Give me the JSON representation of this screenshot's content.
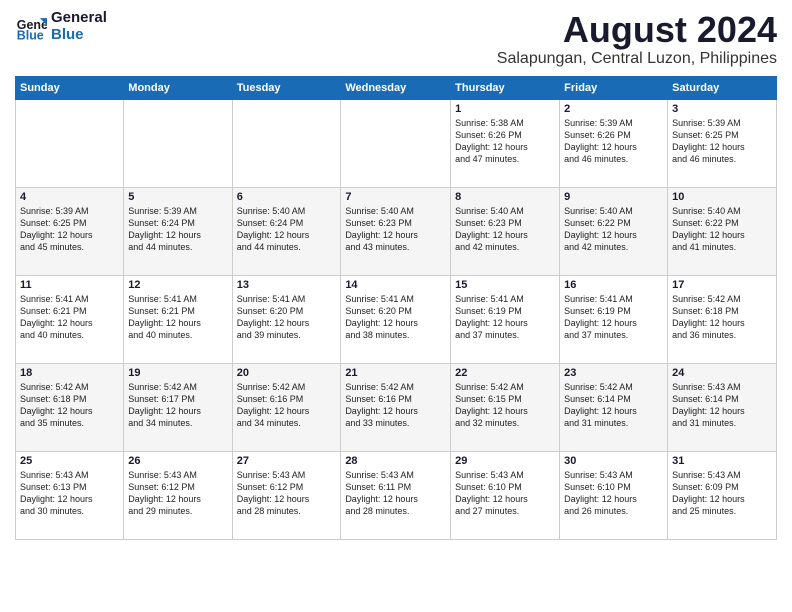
{
  "logo": {
    "line1": "General",
    "line2": "Blue"
  },
  "title": "August 2024",
  "subtitle": "Salapungan, Central Luzon, Philippines",
  "days_header": [
    "Sunday",
    "Monday",
    "Tuesday",
    "Wednesday",
    "Thursday",
    "Friday",
    "Saturday"
  ],
  "weeks": [
    [
      {
        "day": "",
        "info": ""
      },
      {
        "day": "",
        "info": ""
      },
      {
        "day": "",
        "info": ""
      },
      {
        "day": "",
        "info": ""
      },
      {
        "day": "1",
        "info": "Sunrise: 5:38 AM\nSunset: 6:26 PM\nDaylight: 12 hours\nand 47 minutes."
      },
      {
        "day": "2",
        "info": "Sunrise: 5:39 AM\nSunset: 6:26 PM\nDaylight: 12 hours\nand 46 minutes."
      },
      {
        "day": "3",
        "info": "Sunrise: 5:39 AM\nSunset: 6:25 PM\nDaylight: 12 hours\nand 46 minutes."
      }
    ],
    [
      {
        "day": "4",
        "info": "Sunrise: 5:39 AM\nSunset: 6:25 PM\nDaylight: 12 hours\nand 45 minutes."
      },
      {
        "day": "5",
        "info": "Sunrise: 5:39 AM\nSunset: 6:24 PM\nDaylight: 12 hours\nand 44 minutes."
      },
      {
        "day": "6",
        "info": "Sunrise: 5:40 AM\nSunset: 6:24 PM\nDaylight: 12 hours\nand 44 minutes."
      },
      {
        "day": "7",
        "info": "Sunrise: 5:40 AM\nSunset: 6:23 PM\nDaylight: 12 hours\nand 43 minutes."
      },
      {
        "day": "8",
        "info": "Sunrise: 5:40 AM\nSunset: 6:23 PM\nDaylight: 12 hours\nand 42 minutes."
      },
      {
        "day": "9",
        "info": "Sunrise: 5:40 AM\nSunset: 6:22 PM\nDaylight: 12 hours\nand 42 minutes."
      },
      {
        "day": "10",
        "info": "Sunrise: 5:40 AM\nSunset: 6:22 PM\nDaylight: 12 hours\nand 41 minutes."
      }
    ],
    [
      {
        "day": "11",
        "info": "Sunrise: 5:41 AM\nSunset: 6:21 PM\nDaylight: 12 hours\nand 40 minutes."
      },
      {
        "day": "12",
        "info": "Sunrise: 5:41 AM\nSunset: 6:21 PM\nDaylight: 12 hours\nand 40 minutes."
      },
      {
        "day": "13",
        "info": "Sunrise: 5:41 AM\nSunset: 6:20 PM\nDaylight: 12 hours\nand 39 minutes."
      },
      {
        "day": "14",
        "info": "Sunrise: 5:41 AM\nSunset: 6:20 PM\nDaylight: 12 hours\nand 38 minutes."
      },
      {
        "day": "15",
        "info": "Sunrise: 5:41 AM\nSunset: 6:19 PM\nDaylight: 12 hours\nand 37 minutes."
      },
      {
        "day": "16",
        "info": "Sunrise: 5:41 AM\nSunset: 6:19 PM\nDaylight: 12 hours\nand 37 minutes."
      },
      {
        "day": "17",
        "info": "Sunrise: 5:42 AM\nSunset: 6:18 PM\nDaylight: 12 hours\nand 36 minutes."
      }
    ],
    [
      {
        "day": "18",
        "info": "Sunrise: 5:42 AM\nSunset: 6:18 PM\nDaylight: 12 hours\nand 35 minutes."
      },
      {
        "day": "19",
        "info": "Sunrise: 5:42 AM\nSunset: 6:17 PM\nDaylight: 12 hours\nand 34 minutes."
      },
      {
        "day": "20",
        "info": "Sunrise: 5:42 AM\nSunset: 6:16 PM\nDaylight: 12 hours\nand 34 minutes."
      },
      {
        "day": "21",
        "info": "Sunrise: 5:42 AM\nSunset: 6:16 PM\nDaylight: 12 hours\nand 33 minutes."
      },
      {
        "day": "22",
        "info": "Sunrise: 5:42 AM\nSunset: 6:15 PM\nDaylight: 12 hours\nand 32 minutes."
      },
      {
        "day": "23",
        "info": "Sunrise: 5:42 AM\nSunset: 6:14 PM\nDaylight: 12 hours\nand 31 minutes."
      },
      {
        "day": "24",
        "info": "Sunrise: 5:43 AM\nSunset: 6:14 PM\nDaylight: 12 hours\nand 31 minutes."
      }
    ],
    [
      {
        "day": "25",
        "info": "Sunrise: 5:43 AM\nSunset: 6:13 PM\nDaylight: 12 hours\nand 30 minutes."
      },
      {
        "day": "26",
        "info": "Sunrise: 5:43 AM\nSunset: 6:12 PM\nDaylight: 12 hours\nand 29 minutes."
      },
      {
        "day": "27",
        "info": "Sunrise: 5:43 AM\nSunset: 6:12 PM\nDaylight: 12 hours\nand 28 minutes."
      },
      {
        "day": "28",
        "info": "Sunrise: 5:43 AM\nSunset: 6:11 PM\nDaylight: 12 hours\nand 28 minutes."
      },
      {
        "day": "29",
        "info": "Sunrise: 5:43 AM\nSunset: 6:10 PM\nDaylight: 12 hours\nand 27 minutes."
      },
      {
        "day": "30",
        "info": "Sunrise: 5:43 AM\nSunset: 6:10 PM\nDaylight: 12 hours\nand 26 minutes."
      },
      {
        "day": "31",
        "info": "Sunrise: 5:43 AM\nSunset: 6:09 PM\nDaylight: 12 hours\nand 25 minutes."
      }
    ]
  ]
}
